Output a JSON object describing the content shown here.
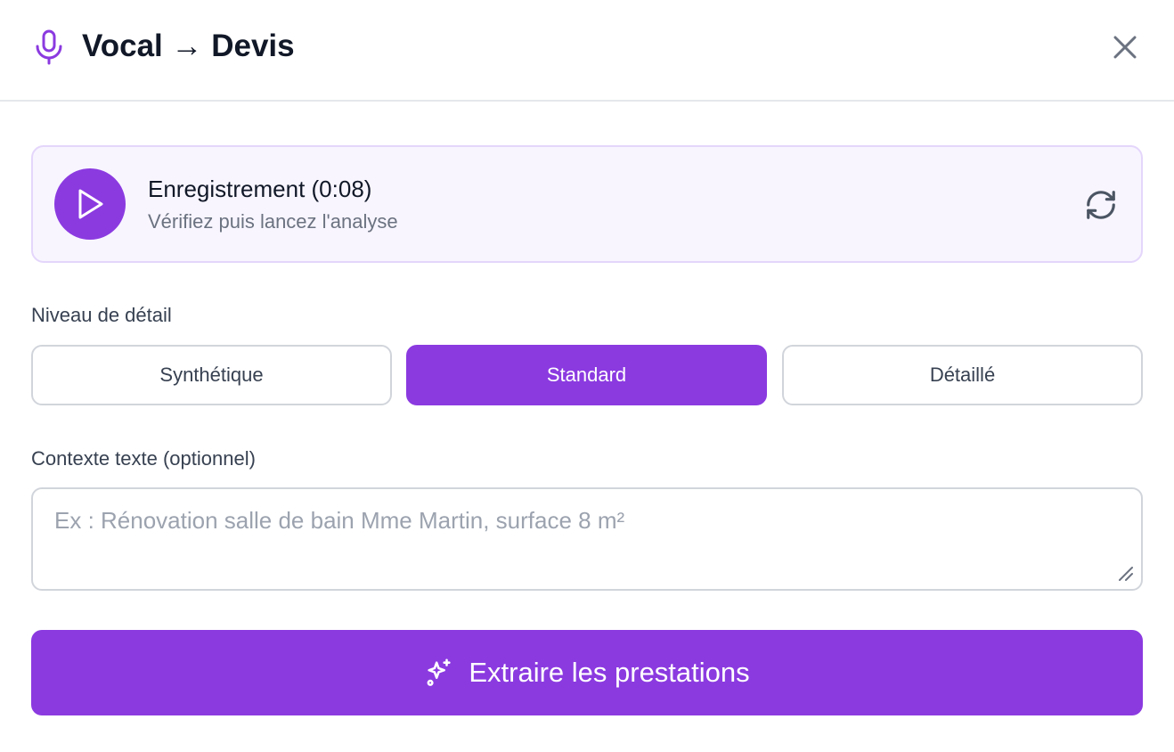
{
  "header": {
    "title": "Vocal → Devis",
    "icon": "microphone-icon",
    "close_icon": "close-icon"
  },
  "recording": {
    "title": "Enregistrement (0:08)",
    "subtitle": "Vérifiez puis lancez l'analyse",
    "play_icon": "play-icon",
    "rerecord_icon": "refresh-icon"
  },
  "detail_level": {
    "label": "Niveau de détail",
    "options": [
      {
        "label": "Synthétique",
        "selected": false
      },
      {
        "label": "Standard",
        "selected": true
      },
      {
        "label": "Détaillé",
        "selected": false
      }
    ]
  },
  "context": {
    "label": "Contexte texte (optionnel)",
    "placeholder": "Ex : Rénovation salle de bain Mme Martin, surface 8 m²",
    "value": ""
  },
  "submit": {
    "label": "Extraire les prestations",
    "icon": "sparkles-icon"
  },
  "colors": {
    "accent": "#8b3ae0",
    "card_bg": "#f8f5ff",
    "card_border": "#e4d6fb",
    "muted_text": "#6b7280",
    "border": "#d1d5db"
  }
}
